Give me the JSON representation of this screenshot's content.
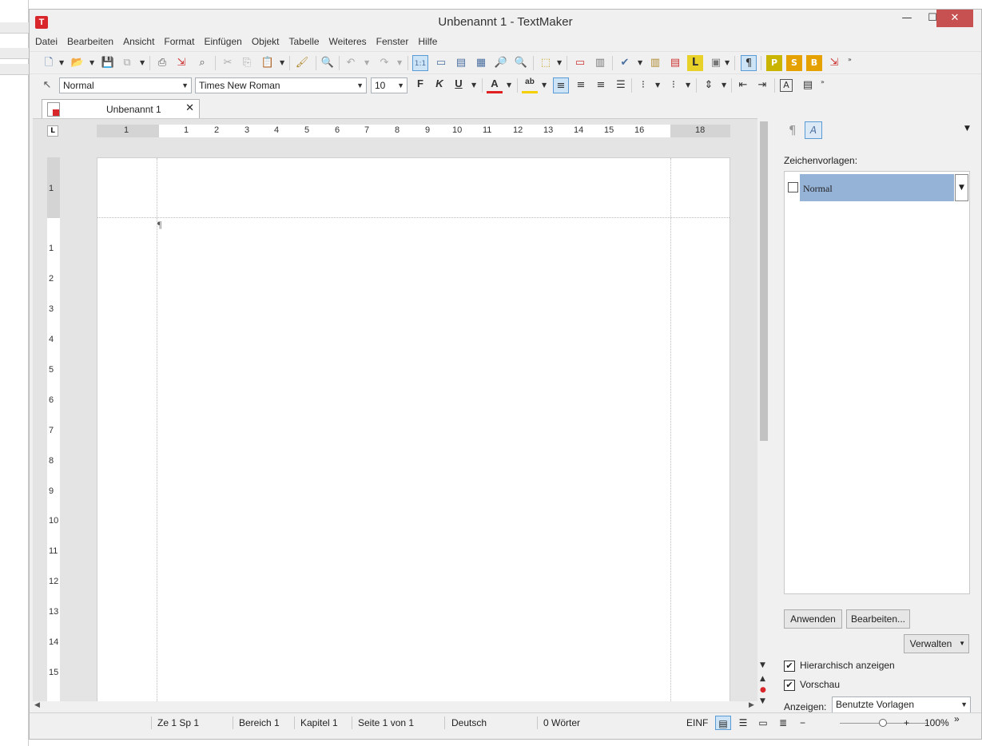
{
  "window": {
    "title": "Unbenannt 1 - TextMaker",
    "app_icon": "T",
    "minimize_icon": "—",
    "maximize_icon": "☐",
    "close_icon": "✕"
  },
  "menu": [
    "Datei",
    "Bearbeiten",
    "Ansicht",
    "Format",
    "Einfügen",
    "Objekt",
    "Tabelle",
    "Weiteres",
    "Fenster",
    "Hilfe"
  ],
  "format_bar": {
    "style": "Normal",
    "font": "Times New Roman",
    "size": "10",
    "bold": "F",
    "italic": "K",
    "underline": "U",
    "font_color": "A",
    "highlight": "ab"
  },
  "tab": {
    "label": "Unbenannt 1",
    "close": "✕"
  },
  "ruler": {
    "h_numbers": [
      "1",
      "1",
      "2",
      "3",
      "4",
      "5",
      "6",
      "7",
      "8",
      "9",
      "10",
      "11",
      "12",
      "13",
      "14",
      "15",
      "16",
      "18"
    ],
    "v_numbers": [
      "1",
      "1",
      "2",
      "3",
      "4",
      "5",
      "6",
      "7",
      "8",
      "9",
      "10",
      "11",
      "12",
      "13",
      "14",
      "15"
    ],
    "corner": "L"
  },
  "document": {
    "pilcrow": "¶"
  },
  "side_panel": {
    "label": "Zeichenvorlagen:",
    "item": "Normal",
    "apply": "Anwenden",
    "edit": "Bearbeiten...",
    "manage": "Verwalten",
    "hierarchical": "Hierarchisch anzeigen",
    "preview": "Vorschau",
    "show_label": "Anzeigen:",
    "show_value": "Benutzte Vorlagen"
  },
  "status": {
    "line": "Ze 1 Sp 1",
    "area": "Bereich 1",
    "chapter": "Kapitel 1",
    "page": "Seite 1 von 1",
    "language": "Deutsch",
    "words": "0 Wörter",
    "mode": "EINF",
    "zoom": "100%"
  },
  "colors": {
    "close": "#c75050",
    "accent": "#4a6ea0",
    "selected_style": "#95b3d7",
    "logo": "#d9262b"
  }
}
